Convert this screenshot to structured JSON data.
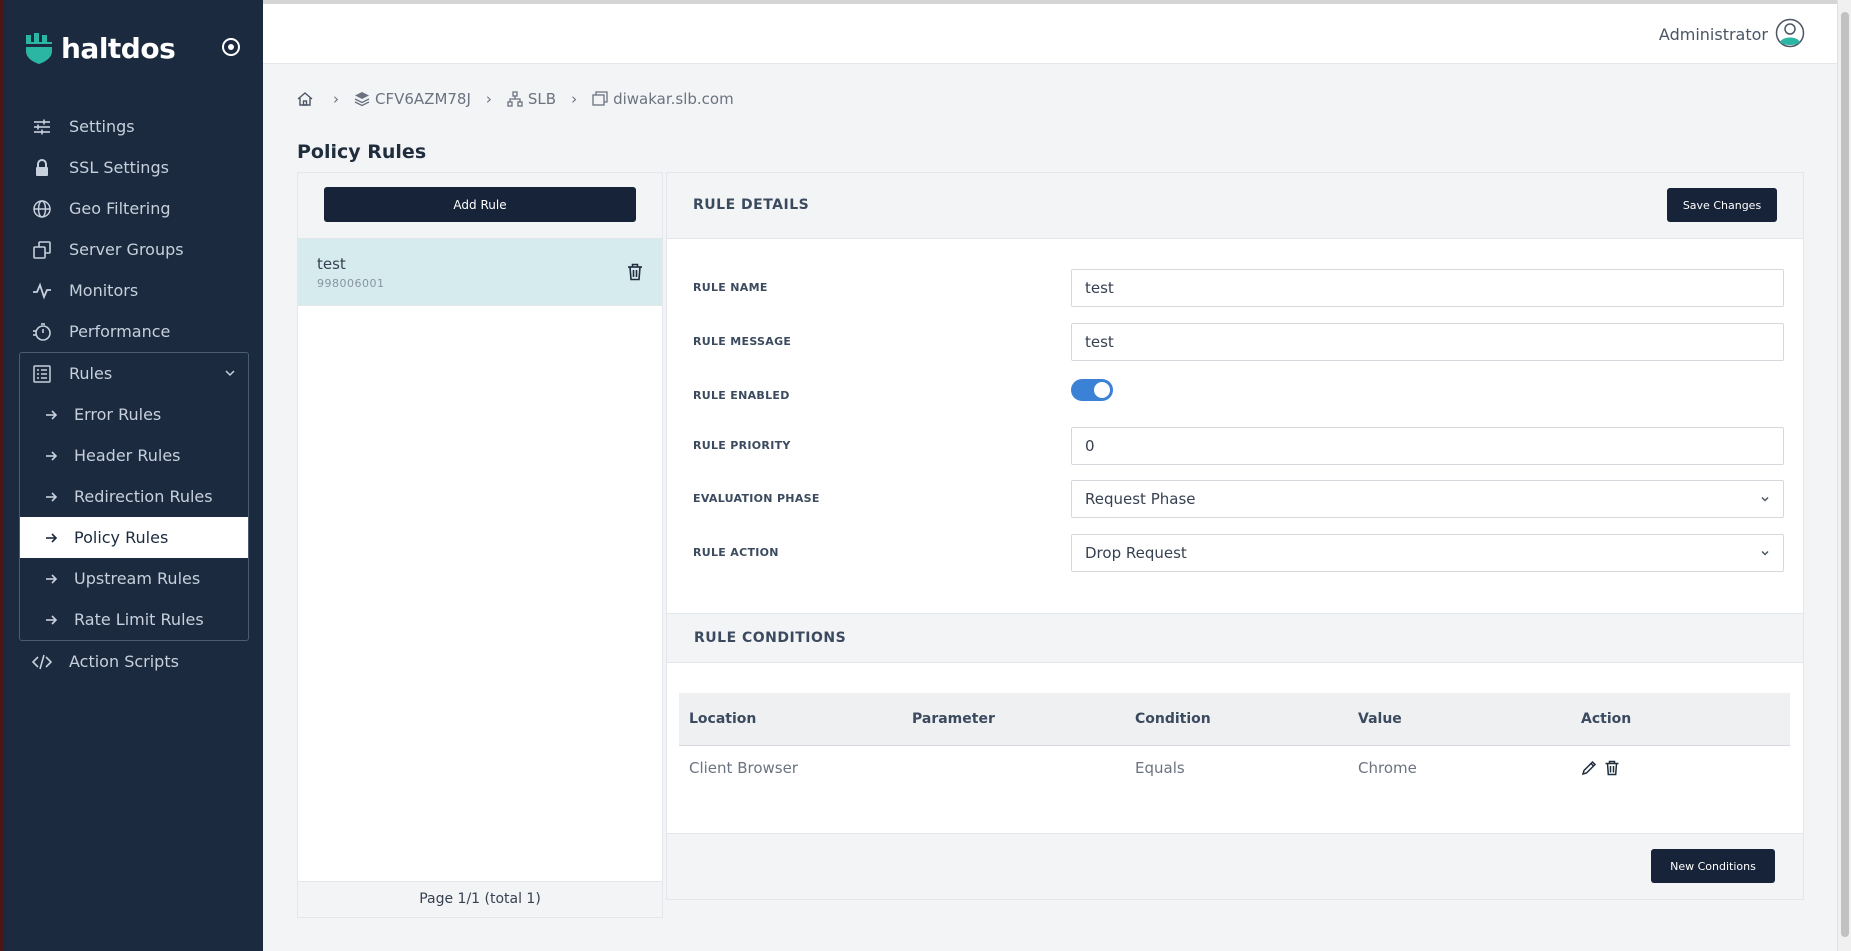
{
  "brand": {
    "name": "haltdos"
  },
  "sidebar": {
    "items": [
      {
        "label": "Settings",
        "icon": "sliders-icon"
      },
      {
        "label": "SSL Settings",
        "icon": "lock-icon"
      },
      {
        "label": "Geo Filtering",
        "icon": "globe-icon"
      },
      {
        "label": "Server Groups",
        "icon": "server-groups-icon"
      },
      {
        "label": "Monitors",
        "icon": "pulse-icon"
      },
      {
        "label": "Performance",
        "icon": "stopwatch-icon"
      }
    ],
    "rules": {
      "label": "Rules",
      "icon": "list-icon",
      "expanded": true,
      "children": [
        {
          "label": "Error Rules"
        },
        {
          "label": "Header Rules"
        },
        {
          "label": "Redirection Rules"
        },
        {
          "label": "Policy Rules",
          "active": true
        },
        {
          "label": "Upstream Rules"
        },
        {
          "label": "Rate Limit Rules"
        }
      ]
    },
    "action_scripts": {
      "label": "Action Scripts",
      "icon": "code-icon"
    }
  },
  "topbar": {
    "user": "Administrator"
  },
  "breadcrumb": {
    "items": [
      {
        "label": "CFV6AZM78J",
        "icon": "layers-icon"
      },
      {
        "label": "SLB",
        "icon": "sitemap-icon"
      },
      {
        "label": "diwakar.slb.com",
        "icon": "window-icon"
      }
    ]
  },
  "page": {
    "title": "Policy Rules"
  },
  "rule_list": {
    "add_label": "Add Rule",
    "rules": [
      {
        "name": "test",
        "id": "998006001"
      }
    ],
    "pagination": "Page 1/1 (total 1)"
  },
  "rule_details": {
    "title": "RULE DETAILS",
    "save_label": "Save Changes",
    "fields": {
      "name": {
        "label": "RULE NAME",
        "value": "test"
      },
      "message": {
        "label": "RULE MESSAGE",
        "value": "test"
      },
      "enabled": {
        "label": "RULE ENABLED",
        "value": true
      },
      "priority": {
        "label": "RULE PRIORITY",
        "value": "0"
      },
      "phase": {
        "label": "EVALUATION PHASE",
        "value": "Request Phase"
      },
      "action": {
        "label": "RULE ACTION",
        "value": "Drop Request"
      }
    }
  },
  "rule_conditions": {
    "title": "RULE CONDITIONS",
    "columns": [
      "Location",
      "Parameter",
      "Condition",
      "Value",
      "Action"
    ],
    "rows": [
      {
        "location": "Client Browser",
        "parameter": "",
        "condition": "Equals",
        "value": "Chrome"
      }
    ],
    "new_label": "New Conditions"
  },
  "colors": {
    "sidebar_bg": "#1b2a3f",
    "primary_button": "#172338",
    "toggle_on": "#3b82d6",
    "selected_row": "#d6ebed",
    "logo_teal": "#2bb5a3"
  }
}
